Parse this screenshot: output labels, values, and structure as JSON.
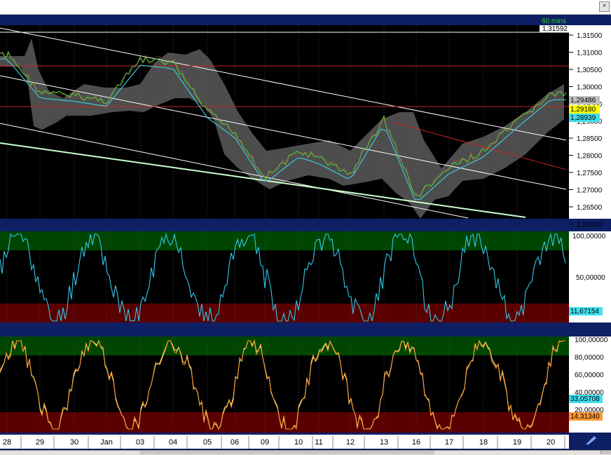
{
  "timeframe": "60 mins",
  "colors": {
    "background": "#000000",
    "frame": "#0f1f63",
    "overbought_zone": "#004600",
    "oversold_zone": "#5a0000",
    "price_line": "#33cc33",
    "ma_line": "#3cc8d8",
    "band_fill": "#5a5a5a",
    "channel_line": "#ffffff",
    "red_line": "#cc2222",
    "support_line": "#ccffcc",
    "stoch_line": "#33c8e8",
    "k_line": "#ff9933",
    "d_line": "#ffff88"
  },
  "price_panel": {
    "y_labels": [
      "1,31500",
      "1,31000",
      "1,30500",
      "1,30000",
      "1,29500",
      "1,29000",
      "1,28500",
      "1,28000",
      "1,27500",
      "1,27000",
      "1,26500",
      "1,26000"
    ],
    "top_value": "1,31592",
    "badges": [
      {
        "value": "1,29486",
        "color": "#c0c0c0"
      },
      {
        "value": "1,29180",
        "color": "#ffff00"
      },
      {
        "value": "1,28939",
        "color": "#40e0f0"
      }
    ]
  },
  "stoch_panel": {
    "y_labels": [
      "100,00000",
      "50,00000"
    ],
    "badge": "11,67154"
  },
  "osc_panel": {
    "y_labels": [
      "100,00000",
      "80,00000",
      "60,00000",
      "40,00000",
      "20,00000"
    ],
    "badges": [
      {
        "value": "33,05708",
        "color": "#40e0f0"
      },
      {
        "value": "14,31340",
        "color": "#ff9933"
      }
    ]
  },
  "x_axis": {
    "labels": [
      "28",
      "29",
      "30",
      "Jan",
      "03",
      "04",
      "05",
      "06",
      "09",
      "10",
      "11",
      "12",
      "13",
      "16",
      "17",
      "18",
      "19",
      "20"
    ]
  },
  "chart_data": {
    "type": "line",
    "x": [
      "28",
      "29",
      "30",
      "Jan",
      "03",
      "04",
      "05",
      "06",
      "09",
      "10",
      "11",
      "12",
      "13",
      "16",
      "17",
      "18",
      "19",
      "20"
    ],
    "series": [
      {
        "values": [
          1.308,
          1.296,
          1.295,
          1.2935,
          1.306,
          1.305,
          1.29,
          1.284,
          1.27,
          1.278,
          1.276,
          1.271,
          1.288,
          1.264,
          1.273,
          1.278,
          1.287,
          1.2955
        ]
      }
    ],
    "ylim": [
      1.2575,
      1.3165
    ]
  }
}
